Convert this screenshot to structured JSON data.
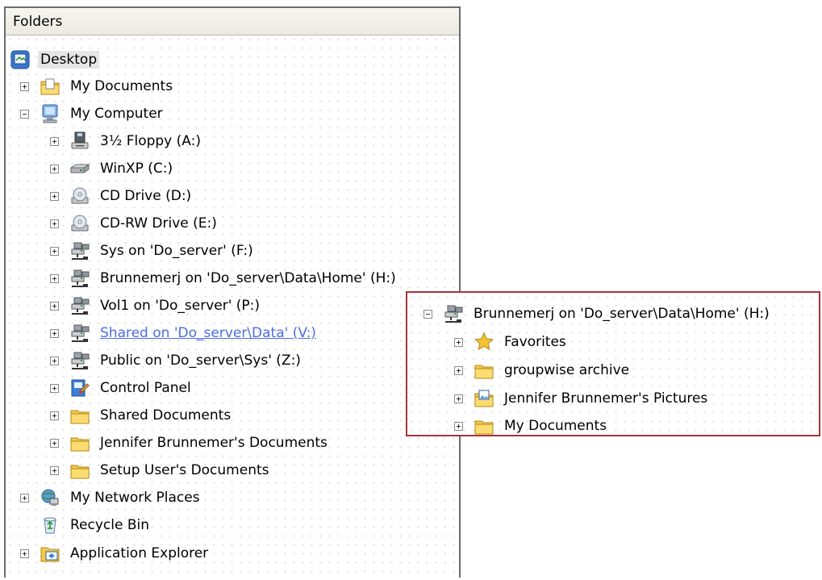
{
  "panel": {
    "header": "Folders"
  },
  "tree": {
    "desktop": {
      "label": "Desktop",
      "icon": "desktop-icon"
    },
    "my_documents": {
      "label": "My Documents",
      "icon": "documents-folder-icon"
    },
    "my_computer": {
      "label": "My Computer",
      "icon": "computer-icon"
    },
    "floppy": {
      "label": "3½ Floppy (A:)",
      "icon": "floppy-drive-icon"
    },
    "winxp": {
      "label": "WinXP (C:)",
      "icon": "hard-drive-icon"
    },
    "cd_drive": {
      "label": "CD Drive (D:)",
      "icon": "cd-drive-icon"
    },
    "cdrw_drive": {
      "label": "CD-RW Drive (E:)",
      "icon": "cd-drive-icon"
    },
    "sys": {
      "label": "Sys on 'Do_server' (F:)",
      "icon": "network-drive-icon"
    },
    "brunnemerj": {
      "label": "Brunnemerj on 'Do_server\\Data\\Home' (H:)",
      "icon": "network-drive-icon"
    },
    "vol1": {
      "label": "Vol1 on 'Do_server' (P:)",
      "icon": "network-drive-icon"
    },
    "shared": {
      "label": "Shared on 'Do_server\\Data' (V:)",
      "icon": "network-drive-icon"
    },
    "public": {
      "label": "Public on 'Do_server\\Sys' (Z:)",
      "icon": "network-drive-icon"
    },
    "control_panel": {
      "label": "Control Panel",
      "icon": "control-panel-icon"
    },
    "shared_documents": {
      "label": "Shared Documents",
      "icon": "folder-icon"
    },
    "jennifer_documents": {
      "label": "Jennifer Brunnemer's Documents",
      "icon": "folder-icon"
    },
    "setup_documents": {
      "label": "Setup User's Documents",
      "icon": "folder-icon"
    },
    "network_places": {
      "label": "My Network Places",
      "icon": "network-places-icon"
    },
    "recycle_bin": {
      "label": "Recycle Bin",
      "icon": "recycle-bin-icon"
    },
    "app_explorer": {
      "label": "Application Explorer",
      "icon": "application-explorer-icon"
    }
  },
  "popout": {
    "root": {
      "label": "Brunnemerj on 'Do_server\\Data\\Home' (H:)",
      "icon": "network-drive-icon"
    },
    "favorites": {
      "label": "Favorites",
      "icon": "star-icon"
    },
    "groupwise": {
      "label": "groupwise archive",
      "icon": "folder-icon"
    },
    "pictures": {
      "label": "Jennifer Brunnemer's Pictures",
      "icon": "pictures-folder-icon"
    },
    "my_documents": {
      "label": "My Documents",
      "icon": "folder-icon"
    }
  },
  "colors": {
    "popout_border": "#a83339",
    "link": "#4c6ee0",
    "folder": "#f4c84a"
  }
}
